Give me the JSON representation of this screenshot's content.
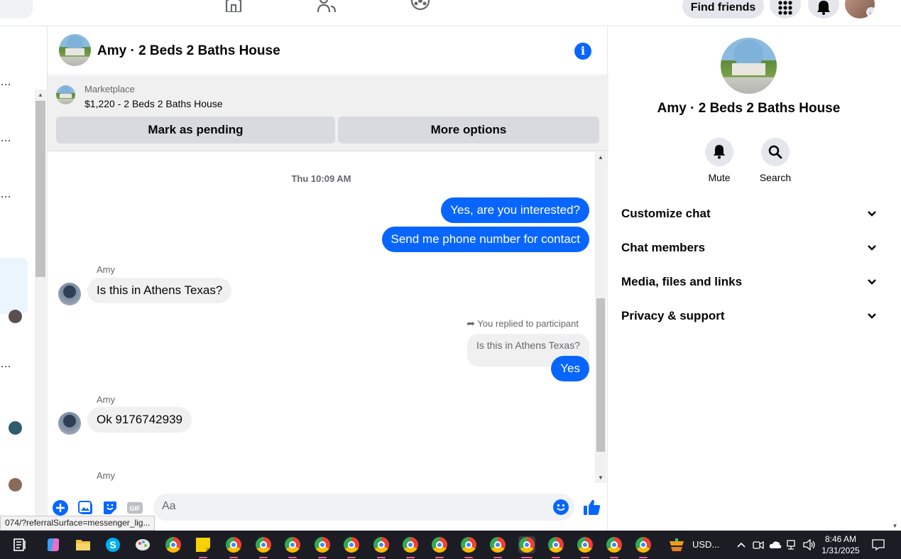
{
  "topnav": {
    "find_friends": "Find friends"
  },
  "chat": {
    "title": "Amy · 2 Beds 2 Baths House",
    "marketplace_label": "Marketplace",
    "listing": "$1,220 - 2 Beds 2 Baths House",
    "mark_pending": "Mark as pending",
    "more_options": "More options",
    "timestamp": "Thu 10:09 AM",
    "messages": [
      {
        "text": "Yes, are you interested?"
      },
      {
        "text": "Send me phone number for contact"
      },
      {
        "sender": "Amy",
        "text": "Is this in Athens Texas?"
      },
      {
        "reply_note": "You replied to participant",
        "quoted": "Is this in Athens Texas?",
        "text": "Yes"
      },
      {
        "sender": "Amy",
        "text": "Ok 9176742939"
      },
      {
        "sender": "Amy"
      }
    ],
    "composer_placeholder": "Aa"
  },
  "right_panel": {
    "title": "Amy · 2 Beds 2 Baths House",
    "mute": "Mute",
    "search": "Search",
    "sections": [
      "Customize chat",
      "Chat members",
      "Media, files and links",
      "Privacy & support"
    ]
  },
  "status_url": "074/?referralSurface=messenger_lig...",
  "taskbar": {
    "weather": "USD...",
    "time": "8:46 AM",
    "date": "1/31/2025"
  },
  "colors": {
    "accent": "#0866ff",
    "bubble_in": "#f0f0f0"
  }
}
